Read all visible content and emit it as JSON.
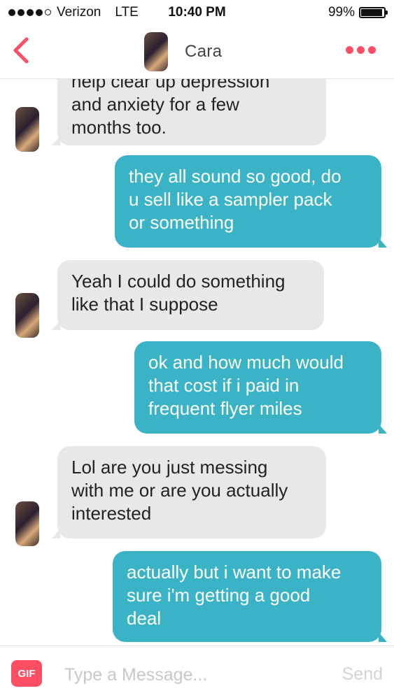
{
  "status_bar": {
    "carrier": "Verizon",
    "network": "LTE",
    "time": "10:40 PM",
    "battery": "99%",
    "battery_level": 0.99,
    "signal_bars": 4,
    "signal_max": 5
  },
  "header": {
    "back_icon": "chevron-left-icon",
    "name": "Cara",
    "more_icon": "more-dots-icon",
    "accent_color": "#fd4f63"
  },
  "messages": [
    {
      "from": "them",
      "lines": [
        "help clear up depression",
        "and anxiety for a few",
        "months too."
      ]
    },
    {
      "from": "me",
      "lines": [
        "they all sound so good, do",
        "u sell like a sampler pack",
        "or something"
      ]
    },
    {
      "from": "them",
      "lines": [
        "Yeah I could do something",
        "like that I suppose"
      ]
    },
    {
      "from": "me",
      "lines": [
        "ok and how much would",
        "that cost if i paid in",
        "frequent flyer miles"
      ]
    },
    {
      "from": "them",
      "lines": [
        "Lol are you just messing",
        "with me or are you actually",
        "interested"
      ]
    },
    {
      "from": "me",
      "lines": [
        "actually but i want to make",
        "sure i'm getting a good",
        "deal"
      ]
    }
  ],
  "composer": {
    "gif_label": "GIF",
    "placeholder": "Type a Message...",
    "send_label": "Send"
  },
  "colors": {
    "sent_bubble": "#3ab3c7",
    "received_bubble": "#e8e8ea"
  }
}
